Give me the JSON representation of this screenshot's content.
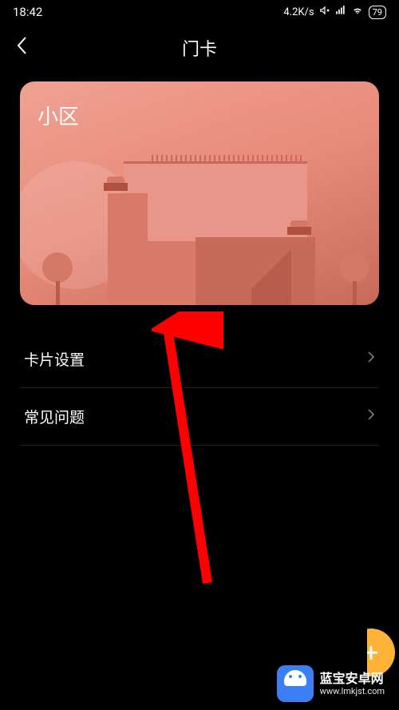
{
  "status": {
    "time": "18:42",
    "network_speed": "4.2K/s",
    "battery": "79"
  },
  "nav": {
    "title": "门卡"
  },
  "card": {
    "label": "小区"
  },
  "menu": {
    "items": [
      {
        "label": "卡片设置"
      },
      {
        "label": "常见问题"
      }
    ]
  },
  "fab": {
    "label": "+"
  },
  "watermark": {
    "title": "蓝宝安卓网",
    "url": "www.lmkjst.com"
  }
}
